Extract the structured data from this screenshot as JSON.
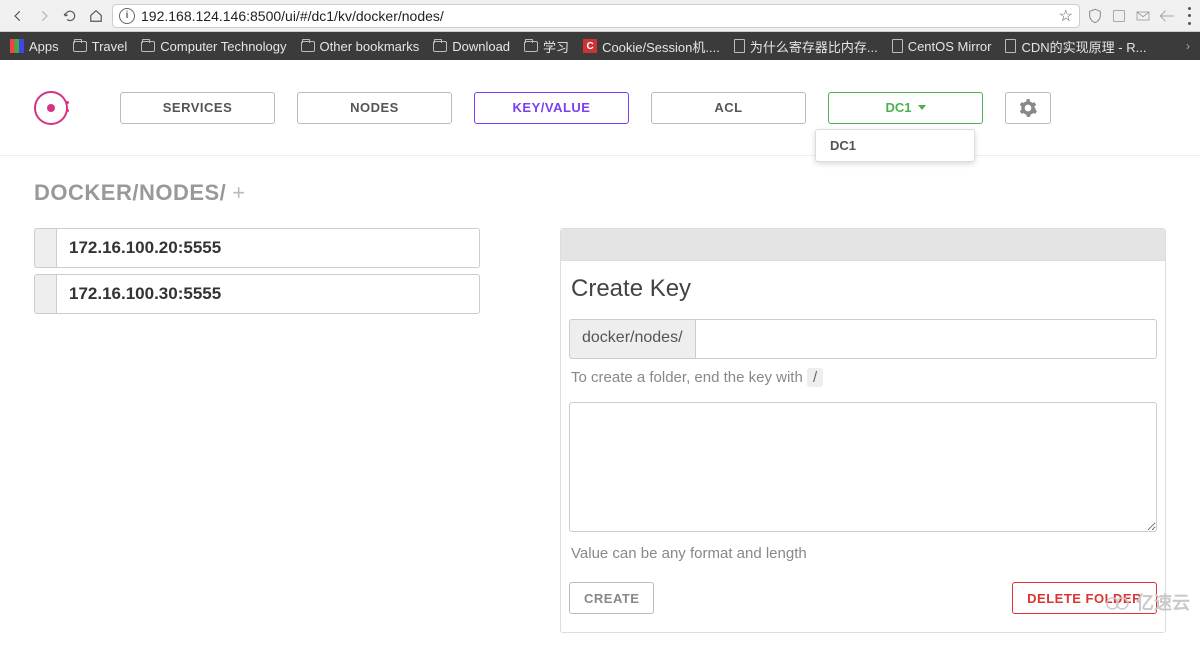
{
  "browser": {
    "url": "192.168.124.146:8500/ui/#/dc1/kv/docker/nodes/",
    "bookmarks": {
      "apps": "Apps",
      "travel": "Travel",
      "computer_tech": "Computer Technology",
      "other": "Other bookmarks",
      "download": "Download",
      "study": "学习",
      "cookie": "Cookie/Session机....",
      "register": "为什么寄存器比内存...",
      "centos": "CentOS Mirror",
      "cdn": "CDN的实现原理 - R..."
    }
  },
  "nav": {
    "services": "SERVICES",
    "nodes": "NODES",
    "kv": "KEY/VALUE",
    "acl": "ACL",
    "dc": "DC1",
    "dc_items": [
      "DC1"
    ]
  },
  "breadcrumb": {
    "path": "DOCKER/NODES/"
  },
  "kv_list": [
    "172.16.100.20:5555",
    "172.16.100.30:5555"
  ],
  "create_panel": {
    "title": "Create Key",
    "prefix": "docker/nodes/",
    "key_hint_pre": "To create a folder, end the key with ",
    "key_hint_slash": "/",
    "value_hint": "Value can be any format and length",
    "create_btn": "CREATE",
    "delete_btn": "DELETE FOLDER"
  },
  "watermark": "亿速云"
}
